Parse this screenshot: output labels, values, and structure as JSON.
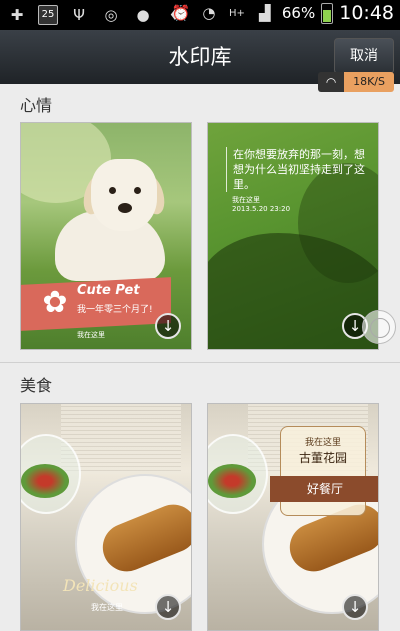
{
  "status_bar": {
    "battery_percent": "66%",
    "time": "10:48",
    "network": "H+",
    "calendar_day": "25",
    "icons": [
      "plus-icon",
      "calendar-icon",
      "usb-icon",
      "gps-icon",
      "app-icon",
      "drop-icon",
      "alarm-icon",
      "wifi-icon",
      "signal-icon",
      "battery-icon"
    ]
  },
  "header": {
    "title": "水印库",
    "cancel_label": "取消"
  },
  "speed_badge": {
    "value": "18K/S"
  },
  "sections": [
    {
      "title": "心情",
      "cards": [
        {
          "name": "cute-pet",
          "title": "Cute Pet",
          "subtitle": "我一年零三个月了!",
          "location": "我在这里"
        },
        {
          "name": "grass-quote",
          "quote": "在你想要放弃的那一刻，想想为什么当初坚持走到了这里。",
          "location": "我在这里",
          "date": "2013.5.20 23:20"
        }
      ]
    },
    {
      "title": "美食",
      "cards": [
        {
          "name": "delicious",
          "title": "Delicious",
          "location": "我在这里"
        },
        {
          "name": "good-restaurant",
          "top": "我在这里",
          "place": "古董花园",
          "ribbon": "好餐厅"
        }
      ]
    }
  ],
  "colors": {
    "header_bg": "#2b3035",
    "page_bg": "#ececec",
    "speed_accent": "#e9a060",
    "pet_banner": "#d9695b"
  }
}
